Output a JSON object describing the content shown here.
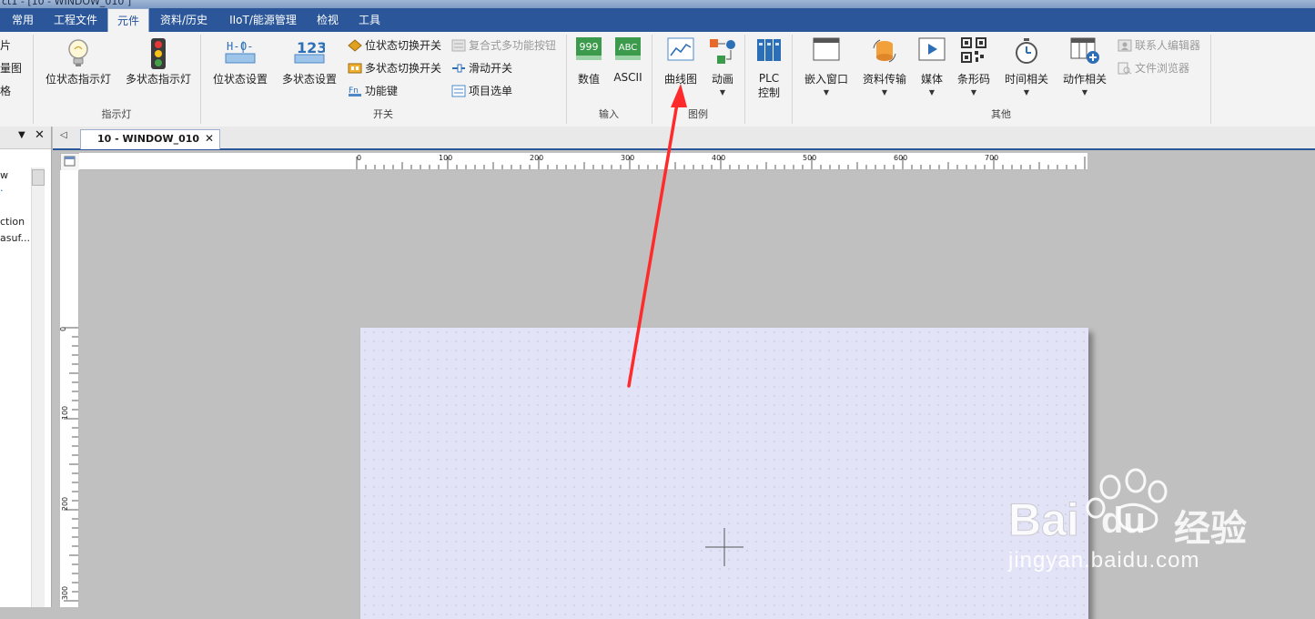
{
  "window": {
    "title": "ct1 - [10 - WINDOW_010 ]"
  },
  "menu": {
    "tabs": [
      {
        "label": "常用",
        "active": false
      },
      {
        "label": "工程文件",
        "active": false
      },
      {
        "label": "元件",
        "active": true
      },
      {
        "label": "资料/历史",
        "active": false
      },
      {
        "label": "IIoT/能源管理",
        "active": false
      },
      {
        "label": "检视",
        "active": false
      },
      {
        "label": "工具",
        "active": false
      }
    ]
  },
  "ribbon": {
    "partial_items": [
      "图片",
      "向量图",
      "表格"
    ],
    "indicator": {
      "group_label": "指示灯",
      "bit_lamp": "位状态指示灯",
      "multi_lamp": "多状态指示灯"
    },
    "switch": {
      "group_label": "开关",
      "bit_set": "位状态设置",
      "word_set": "多状态设置",
      "bit_toggle": "位状态切换开关",
      "multi_toggle": "多状态切换开关",
      "function_key": "功能键",
      "combo_button": "复合式多功能按钮",
      "slide_switch": "滑动开关",
      "item_select": "项目选单"
    },
    "input": {
      "group_label": "输入",
      "numeric": "数值",
      "numeric_icon_text": "999",
      "ascii": "ASCII",
      "ascii_icon_text": "ABC"
    },
    "graph": {
      "group_label": "图例",
      "trend": "曲线图",
      "animation": "动画"
    },
    "plc_control": "PLC 控制",
    "others": {
      "group_label": "其他",
      "embedded_window": "嵌入窗口",
      "data_transfer": "资料传输",
      "media": "媒体",
      "barcode": "条形码",
      "time_related": "时间相关",
      "action_related": "动作相关",
      "contact_editor": "联系人编辑器",
      "file_browser": "文件浏览器"
    }
  },
  "left_panel": {
    "lines": [
      "w",
      "ction",
      "asuf..."
    ]
  },
  "document": {
    "tab_label": "10 - WINDOW_010",
    "ruler_h_labels": [
      "0",
      "100",
      "200",
      "300",
      "400",
      "500",
      "600",
      "700"
    ],
    "ruler_v_labels": [
      "0",
      "100",
      "200",
      "300"
    ]
  },
  "watermark": {
    "brand": "Bai",
    "brand_du": "du",
    "brand_suffix": "经验",
    "url": "jingyan.baidu.com"
  },
  "colors": {
    "menubar": "#2b579a",
    "canvas": "#e3e3f7",
    "arrow": "#ff2a2a"
  }
}
